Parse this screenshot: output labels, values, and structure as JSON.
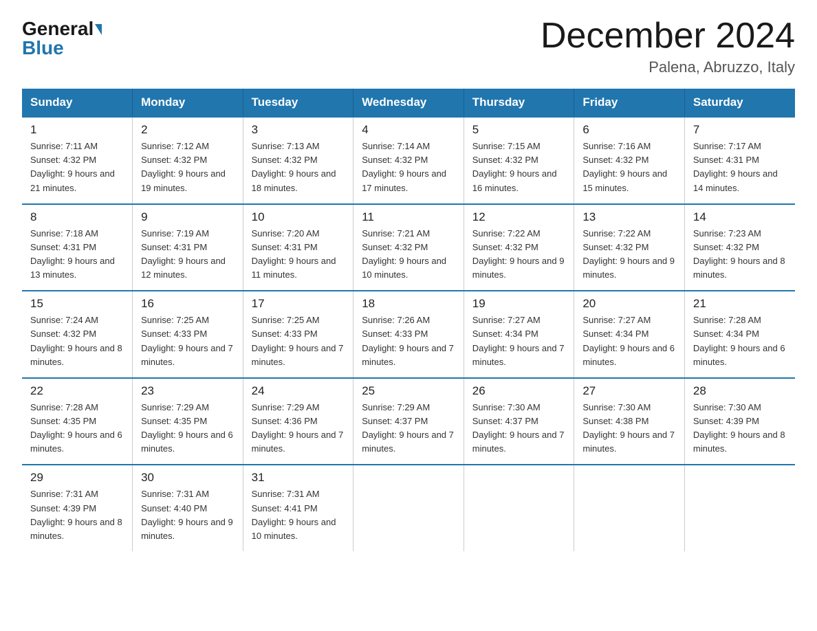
{
  "logo": {
    "general": "General",
    "blue": "Blue"
  },
  "title": "December 2024",
  "location": "Palena, Abruzzo, Italy",
  "days_header": [
    "Sunday",
    "Monday",
    "Tuesday",
    "Wednesday",
    "Thursday",
    "Friday",
    "Saturday"
  ],
  "weeks": [
    [
      {
        "day": "1",
        "sunrise": "Sunrise: 7:11 AM",
        "sunset": "Sunset: 4:32 PM",
        "daylight": "Daylight: 9 hours and 21 minutes."
      },
      {
        "day": "2",
        "sunrise": "Sunrise: 7:12 AM",
        "sunset": "Sunset: 4:32 PM",
        "daylight": "Daylight: 9 hours and 19 minutes."
      },
      {
        "day": "3",
        "sunrise": "Sunrise: 7:13 AM",
        "sunset": "Sunset: 4:32 PM",
        "daylight": "Daylight: 9 hours and 18 minutes."
      },
      {
        "day": "4",
        "sunrise": "Sunrise: 7:14 AM",
        "sunset": "Sunset: 4:32 PM",
        "daylight": "Daylight: 9 hours and 17 minutes."
      },
      {
        "day": "5",
        "sunrise": "Sunrise: 7:15 AM",
        "sunset": "Sunset: 4:32 PM",
        "daylight": "Daylight: 9 hours and 16 minutes."
      },
      {
        "day": "6",
        "sunrise": "Sunrise: 7:16 AM",
        "sunset": "Sunset: 4:32 PM",
        "daylight": "Daylight: 9 hours and 15 minutes."
      },
      {
        "day": "7",
        "sunrise": "Sunrise: 7:17 AM",
        "sunset": "Sunset: 4:31 PM",
        "daylight": "Daylight: 9 hours and 14 minutes."
      }
    ],
    [
      {
        "day": "8",
        "sunrise": "Sunrise: 7:18 AM",
        "sunset": "Sunset: 4:31 PM",
        "daylight": "Daylight: 9 hours and 13 minutes."
      },
      {
        "day": "9",
        "sunrise": "Sunrise: 7:19 AM",
        "sunset": "Sunset: 4:31 PM",
        "daylight": "Daylight: 9 hours and 12 minutes."
      },
      {
        "day": "10",
        "sunrise": "Sunrise: 7:20 AM",
        "sunset": "Sunset: 4:31 PM",
        "daylight": "Daylight: 9 hours and 11 minutes."
      },
      {
        "day": "11",
        "sunrise": "Sunrise: 7:21 AM",
        "sunset": "Sunset: 4:32 PM",
        "daylight": "Daylight: 9 hours and 10 minutes."
      },
      {
        "day": "12",
        "sunrise": "Sunrise: 7:22 AM",
        "sunset": "Sunset: 4:32 PM",
        "daylight": "Daylight: 9 hours and 9 minutes."
      },
      {
        "day": "13",
        "sunrise": "Sunrise: 7:22 AM",
        "sunset": "Sunset: 4:32 PM",
        "daylight": "Daylight: 9 hours and 9 minutes."
      },
      {
        "day": "14",
        "sunrise": "Sunrise: 7:23 AM",
        "sunset": "Sunset: 4:32 PM",
        "daylight": "Daylight: 9 hours and 8 minutes."
      }
    ],
    [
      {
        "day": "15",
        "sunrise": "Sunrise: 7:24 AM",
        "sunset": "Sunset: 4:32 PM",
        "daylight": "Daylight: 9 hours and 8 minutes."
      },
      {
        "day": "16",
        "sunrise": "Sunrise: 7:25 AM",
        "sunset": "Sunset: 4:33 PM",
        "daylight": "Daylight: 9 hours and 7 minutes."
      },
      {
        "day": "17",
        "sunrise": "Sunrise: 7:25 AM",
        "sunset": "Sunset: 4:33 PM",
        "daylight": "Daylight: 9 hours and 7 minutes."
      },
      {
        "day": "18",
        "sunrise": "Sunrise: 7:26 AM",
        "sunset": "Sunset: 4:33 PM",
        "daylight": "Daylight: 9 hours and 7 minutes."
      },
      {
        "day": "19",
        "sunrise": "Sunrise: 7:27 AM",
        "sunset": "Sunset: 4:34 PM",
        "daylight": "Daylight: 9 hours and 7 minutes."
      },
      {
        "day": "20",
        "sunrise": "Sunrise: 7:27 AM",
        "sunset": "Sunset: 4:34 PM",
        "daylight": "Daylight: 9 hours and 6 minutes."
      },
      {
        "day": "21",
        "sunrise": "Sunrise: 7:28 AM",
        "sunset": "Sunset: 4:34 PM",
        "daylight": "Daylight: 9 hours and 6 minutes."
      }
    ],
    [
      {
        "day": "22",
        "sunrise": "Sunrise: 7:28 AM",
        "sunset": "Sunset: 4:35 PM",
        "daylight": "Daylight: 9 hours and 6 minutes."
      },
      {
        "day": "23",
        "sunrise": "Sunrise: 7:29 AM",
        "sunset": "Sunset: 4:35 PM",
        "daylight": "Daylight: 9 hours and 6 minutes."
      },
      {
        "day": "24",
        "sunrise": "Sunrise: 7:29 AM",
        "sunset": "Sunset: 4:36 PM",
        "daylight": "Daylight: 9 hours and 7 minutes."
      },
      {
        "day": "25",
        "sunrise": "Sunrise: 7:29 AM",
        "sunset": "Sunset: 4:37 PM",
        "daylight": "Daylight: 9 hours and 7 minutes."
      },
      {
        "day": "26",
        "sunrise": "Sunrise: 7:30 AM",
        "sunset": "Sunset: 4:37 PM",
        "daylight": "Daylight: 9 hours and 7 minutes."
      },
      {
        "day": "27",
        "sunrise": "Sunrise: 7:30 AM",
        "sunset": "Sunset: 4:38 PM",
        "daylight": "Daylight: 9 hours and 7 minutes."
      },
      {
        "day": "28",
        "sunrise": "Sunrise: 7:30 AM",
        "sunset": "Sunset: 4:39 PM",
        "daylight": "Daylight: 9 hours and 8 minutes."
      }
    ],
    [
      {
        "day": "29",
        "sunrise": "Sunrise: 7:31 AM",
        "sunset": "Sunset: 4:39 PM",
        "daylight": "Daylight: 9 hours and 8 minutes."
      },
      {
        "day": "30",
        "sunrise": "Sunrise: 7:31 AM",
        "sunset": "Sunset: 4:40 PM",
        "daylight": "Daylight: 9 hours and 9 minutes."
      },
      {
        "day": "31",
        "sunrise": "Sunrise: 7:31 AM",
        "sunset": "Sunset: 4:41 PM",
        "daylight": "Daylight: 9 hours and 10 minutes."
      },
      null,
      null,
      null,
      null
    ]
  ]
}
